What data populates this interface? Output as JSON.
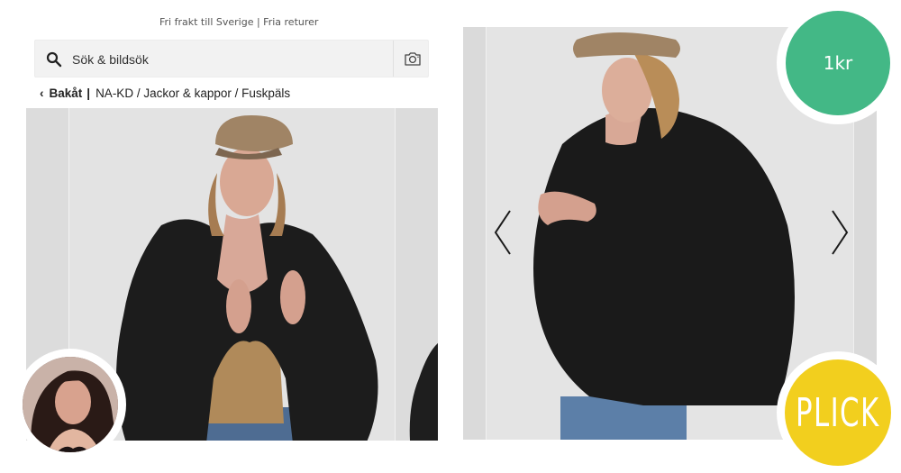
{
  "app": {
    "top_notice": "Fri frakt till Sverige | Fria returer"
  },
  "search": {
    "placeholder": "Sök & bildsök",
    "icon": "search-icon",
    "camera_icon": "camera-icon"
  },
  "breadcrumb": {
    "back_label": "Bakåt",
    "path": "NA-KD / Jackor & kappor / Fuskpäls"
  },
  "listing": {
    "price": "1kr",
    "brand_badge": "PLICK",
    "price_color": "#43b886",
    "brand_color": "#f2cf1e"
  },
  "gallery": {
    "prev_icon": "chevron-left-icon",
    "next_icon": "chevron-right-icon"
  }
}
